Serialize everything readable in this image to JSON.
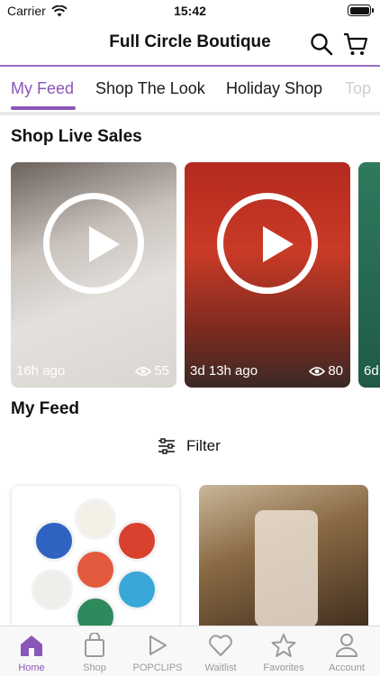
{
  "status": {
    "carrier": "Carrier",
    "time": "15:42"
  },
  "header": {
    "title": "Full Circle Boutique",
    "search_icon": "search-icon",
    "cart_icon": "cart-icon"
  },
  "tabs": [
    {
      "label": "My Feed",
      "active": true
    },
    {
      "label": "Shop The Look",
      "active": false
    },
    {
      "label": "Holiday Shop",
      "active": false
    },
    {
      "label": "Top",
      "active": false
    }
  ],
  "live_sales": {
    "title": "Shop Live Sales",
    "cards": [
      {
        "time": "16h ago",
        "views": "55"
      },
      {
        "time": "3d 13h ago",
        "views": "80"
      },
      {
        "time": "6d",
        "views": ""
      }
    ]
  },
  "feed": {
    "title": "My Feed",
    "filter_label": "Filter"
  },
  "bottom_nav": [
    {
      "label": "Home",
      "icon": "home-icon",
      "active": true
    },
    {
      "label": "Shop",
      "icon": "shopping-bag-icon",
      "active": false
    },
    {
      "label": "POPCLIPS",
      "icon": "play-icon",
      "active": false
    },
    {
      "label": "Waitlist",
      "icon": "heart-icon",
      "active": false
    },
    {
      "label": "Favorites",
      "icon": "star-icon",
      "active": false
    },
    {
      "label": "Account",
      "icon": "person-icon",
      "active": false
    }
  ],
  "colors": {
    "accent": "#8a56b8",
    "inactive": "#9a9a9a"
  }
}
